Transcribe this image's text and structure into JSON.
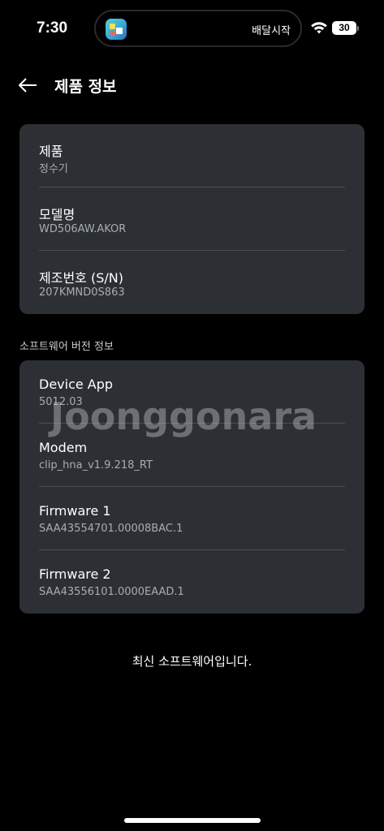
{
  "status_bar": {
    "time": "7:30",
    "island_text": "배달시작",
    "battery": "30"
  },
  "header": {
    "title": "제품 정보"
  },
  "product_card": {
    "rows": [
      {
        "label": "제품",
        "value": "정수기"
      },
      {
        "label": "모델명",
        "value": "WD506AW.AKOR"
      },
      {
        "label": "제조번호 (S/N)",
        "value": "207KMND0S863"
      }
    ]
  },
  "software_section": {
    "header": "소프트웨어 버전 정보",
    "rows": [
      {
        "label": "Device App",
        "value": "5012.03"
      },
      {
        "label": "Modem",
        "value": "clip_hna_v1.9.218_RT"
      },
      {
        "label": "Firmware 1",
        "value": "SAA43554701.00008BAC.1"
      },
      {
        "label": "Firmware 2",
        "value": "SAA43556101.0000EAAD.1"
      }
    ]
  },
  "watermark": "Joonggonara",
  "status_message": "최신 소프트웨어입니다.",
  "icons": {
    "back": "arrow-left-icon",
    "wifi": "wifi-icon",
    "app": "app-icon"
  },
  "colors": {
    "background": "#000000",
    "card": "#2c3034",
    "divider": "#4a4f53",
    "secondary_text": "#a8adb1"
  }
}
